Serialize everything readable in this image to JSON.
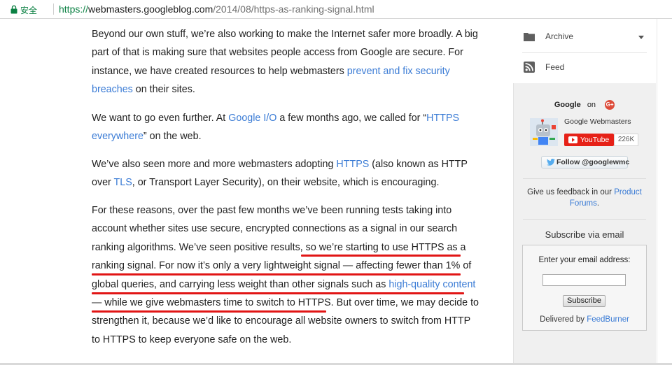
{
  "browser": {
    "secure_label": "安全",
    "url_scheme": "https://",
    "url_host": "webmasters.googleblog.com",
    "url_path": "/2014/08/https-as-ranking-signal.html"
  },
  "article": {
    "p1": [
      [
        {
          "t": "Beyond our own stuff, we’re also working to make the Internet safer more broadly. A big"
        }
      ],
      [
        {
          "t": "part of that is making sure that websites people access from Google are secure. For"
        }
      ],
      [
        {
          "t": "instance, we have created resources to help webmasters "
        },
        {
          "t": "prevent and fix security",
          "link": true
        }
      ],
      [
        {
          "t": "breaches",
          "link": true
        },
        {
          "t": " on their sites."
        }
      ]
    ],
    "p2": [
      [
        {
          "t": "We want to go even further. At "
        },
        {
          "t": "Google I/O",
          "link": true
        },
        {
          "t": " a few months ago, we called for “"
        },
        {
          "t": "HTTPS",
          "link": true
        }
      ],
      [
        {
          "t": "everywhere",
          "link": true
        },
        {
          "t": "” on the web."
        }
      ]
    ],
    "p3": [
      [
        {
          "t": "We’ve also seen more and more webmasters adopting "
        },
        {
          "t": "HTTPS",
          "link": true
        },
        {
          "t": " (also known as HTTP"
        }
      ],
      [
        {
          "t": "over "
        },
        {
          "t": "TLS",
          "link": true
        },
        {
          "t": ", or Transport Layer Security), on their website, which is encouraging."
        }
      ]
    ],
    "p4": [
      [
        {
          "t": "For these reasons, over the past few months we’ve been running tests taking into"
        }
      ],
      [
        {
          "t": "account whether sites use secure, encrypted connections as a signal in our search"
        }
      ],
      [
        {
          "t": "ranking algorithms. We’ve seen positive results, so we’re starting to use HTTPS as a"
        }
      ],
      [
        {
          "t": "ranking signal. For now it’s only a very lightweight signal — affecting fewer than 1% of"
        }
      ],
      [
        {
          "t": "global queries, and carrying less weight than other signals such as "
        },
        {
          "t": "high-quality content",
          "link": true
        }
      ],
      [
        {
          "t": "— while we give webmasters time to switch to HTTPS. But over time, we may decide to"
        }
      ],
      [
        {
          "t": "strengthen it, because we’d like to encourage all website owners to switch from HTTP"
        }
      ],
      [
        {
          "t": "to HTTPS to keep everyone safe on the web."
        }
      ]
    ]
  },
  "sidebar": {
    "archive_label": "Archive",
    "feed_label": "Feed",
    "google_label": "Google",
    "on_label": "on",
    "gplus_label": "G+",
    "channel_name": "Google Webmasters",
    "youtube_label": "YouTube",
    "youtube_count": "226K",
    "twitter_label": "Follow @googlewmc",
    "feedback_text": "Give us feedback in our ",
    "feedback_link": "Product Forums",
    "feedback_end": ".",
    "subscribe_title": "Subscribe via email",
    "email_label": "Enter your email address:",
    "subscribe_button": "Subscribe",
    "delivered_text": "Delivered by ",
    "delivered_link": "FeedBurner"
  },
  "colors": {
    "link": "#3a7bd5",
    "highlight_underline": "#e11515",
    "secure_green": "#0b8043",
    "youtube_red": "#e62117",
    "gplus_red": "#dd4b39"
  }
}
